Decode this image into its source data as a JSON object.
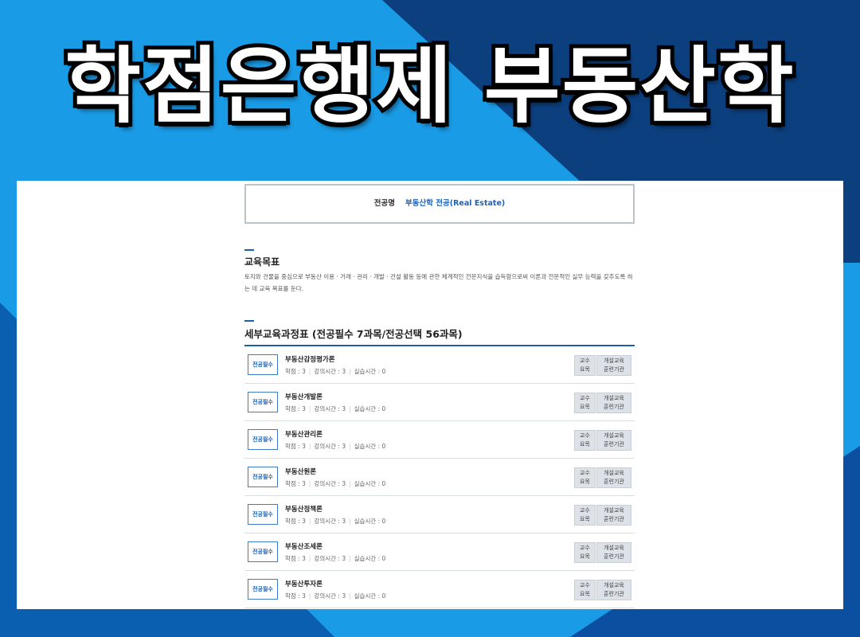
{
  "headline": "학점은행제 부동산학",
  "major": {
    "label": "전공명",
    "value": "부동산학 전공(Real Estate)"
  },
  "goal": {
    "title": "교육목표",
    "text": "토지와 건물을 중심으로 부동산 이용 · 거래 · 관리 · 개발 · 건설 활동 등에 관한 체계적인 전문지식을 습득함으로써 이론과 전문적인 실무 능력을 갖추도록 하는 데 교육 목표를 둔다."
  },
  "detail": {
    "title": "세부교육과정표 (전공필수 7과목/전공선택 56과목)"
  },
  "info_labels": {
    "credit": "학점 : ",
    "lecture": "강의시간 : ",
    "practice": "실습시간 : "
  },
  "buttons": {
    "professor": [
      "교수",
      "요목"
    ],
    "institution": [
      "개설교육",
      "훈련기관"
    ]
  },
  "courses": [
    {
      "badge": "전공필수",
      "name": "부동산감정평가론",
      "credit": "3",
      "lecture": "3",
      "practice": "0"
    },
    {
      "badge": "전공필수",
      "name": "부동산개발론",
      "credit": "3",
      "lecture": "3",
      "practice": "0"
    },
    {
      "badge": "전공필수",
      "name": "부동산관리론",
      "credit": "3",
      "lecture": "3",
      "practice": "0"
    },
    {
      "badge": "전공필수",
      "name": "부동산원론",
      "credit": "3",
      "lecture": "3",
      "practice": "0"
    },
    {
      "badge": "전공필수",
      "name": "부동산정책론",
      "credit": "3",
      "lecture": "3",
      "practice": "0"
    },
    {
      "badge": "전공필수",
      "name": "부동산조세론",
      "credit": "3",
      "lecture": "3",
      "practice": "0"
    },
    {
      "badge": "전공필수",
      "name": "부동산투자론",
      "credit": "3",
      "lecture": "3",
      "practice": "0"
    }
  ],
  "colors": {
    "accent": "#1f5ea8",
    "background": "#1a9be6",
    "dark_shape": "#0b3f7e"
  }
}
